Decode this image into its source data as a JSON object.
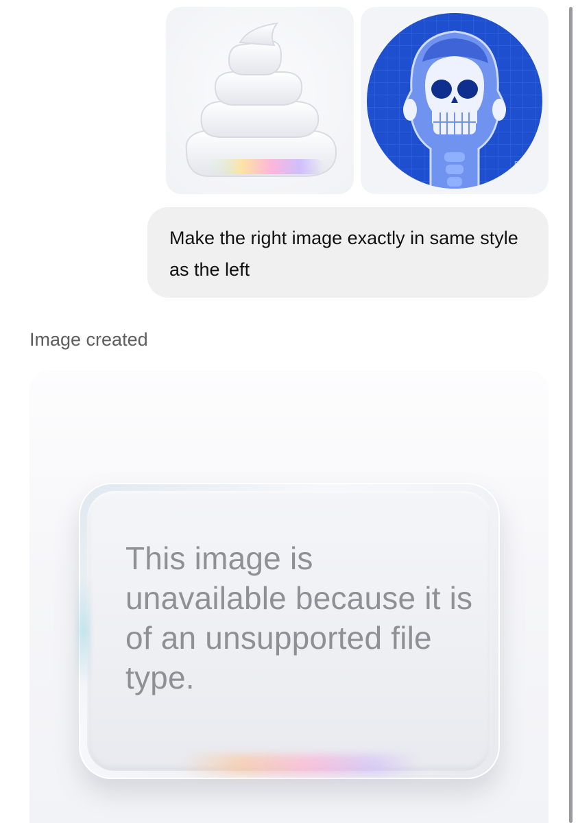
{
  "attachments": [
    {
      "description_icon": "swirl-emoji-icon"
    },
    {
      "description_icon": "skull-xray-icon"
    }
  ],
  "message": {
    "text": "Make the right image exactly in same style as the left"
  },
  "status": {
    "label": "Image created"
  },
  "generated_image": {
    "placeholder_text": "This image is unavailable because it is of an unsupported file type."
  },
  "colors": {
    "bubble_bg": "#f0f0f0",
    "xray_blue": "#1f4fd1",
    "placeholder_text": "#8e9096"
  }
}
